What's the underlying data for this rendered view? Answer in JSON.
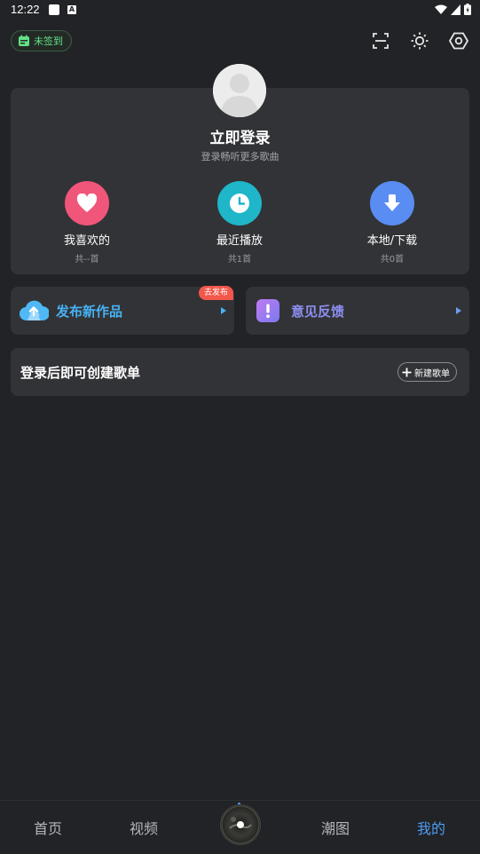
{
  "status_bar": {
    "time": "12:22",
    "notif_letter": "A"
  },
  "header": {
    "signin_label": "未签到"
  },
  "profile": {
    "title": "立即登录",
    "subtitle": "登录畅听更多歌曲",
    "quick_actions": [
      {
        "label": "我喜欢的",
        "count": "共--首",
        "icon": "heart-icon",
        "color": "#f0567a"
      },
      {
        "label": "最近播放",
        "count": "共1首",
        "icon": "clock-icon",
        "color": "#1fb6c9"
      },
      {
        "label": "本地/下载",
        "count": "共0首",
        "icon": "download-icon",
        "color": "#5a8df2"
      }
    ]
  },
  "publish": {
    "label": "发布新作品",
    "tag": "去发布",
    "color": "#47b2f3",
    "icon": "cloud-upload-icon"
  },
  "feedback": {
    "label": "意见反馈",
    "color": "#8c8ff2",
    "icon": "exclamation-icon"
  },
  "playlist": {
    "prompt": "登录后即可创建歌单",
    "new_button": "新建歌单"
  },
  "bottom_nav": {
    "items": [
      "首页",
      "视频",
      "潮图",
      "我的"
    ],
    "active": "我的",
    "active_color": "#4d9bf5"
  }
}
